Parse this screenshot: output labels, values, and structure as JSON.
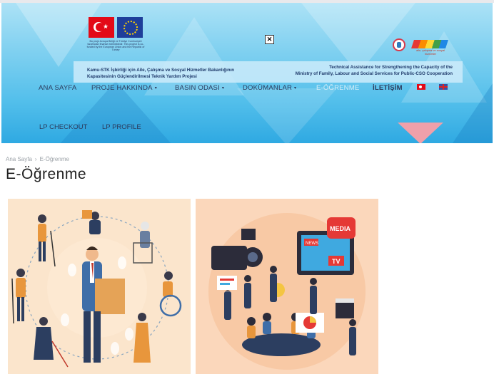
{
  "header": {
    "logo_caption": "Bu proje Avrupa Birliği ve Türkiye Cumhuriyeti tarafından finanse edilmektedir. This project is co-funded by the European Union and the Republic of Turkey",
    "band_left_line1": "Kamu-STK İşbirliği için Aile, Çalışma ve Sosyal Hizmetler Bakanlığının",
    "band_left_line2": "Kapasitesinin Güçlendirilmesi Teknik Yardım Projesi",
    "band_right_line1": "Technical Assistance for Strengthening the Capacity of the",
    "band_right_line2": "Ministry of Family, Labour and Social Services for Public-CSO Cooperation",
    "partner_caption": "aile, çalışma ve sosyal hizmetler",
    "close_symbol": "✕"
  },
  "nav": {
    "items": [
      {
        "label": "ANA SAYFA"
      },
      {
        "label": "PROJE HAKKINDA"
      },
      {
        "label": "BASIN ODASI"
      },
      {
        "label": "DOKÜMANLAR"
      },
      {
        "label": "E-ÖĞRENME"
      },
      {
        "label": "İLETİŞİM"
      }
    ],
    "sub_items": [
      {
        "label": "LP CHECKOUT"
      },
      {
        "label": "LP PROFILE"
      }
    ],
    "caret": "▾"
  },
  "breadcrumb": {
    "home": "Ana Sayfa",
    "separator": "›",
    "current": "E-Öğrenme"
  },
  "page_title": "E-Öğrenme",
  "colors": {
    "header_top": "#ace2f6",
    "header_bottom": "#2fa9e2",
    "nav_text": "#2b3a5c",
    "card1_bg": "#fbe5cc",
    "card2_bg": "#fbd7bb"
  },
  "cards": [
    {
      "image": "disability-inclusion-illustration"
    },
    {
      "image": "media-communication-illustration"
    }
  ],
  "media_labels": {
    "media": "MEDIA",
    "news": "NEWS",
    "tv": "TV"
  }
}
